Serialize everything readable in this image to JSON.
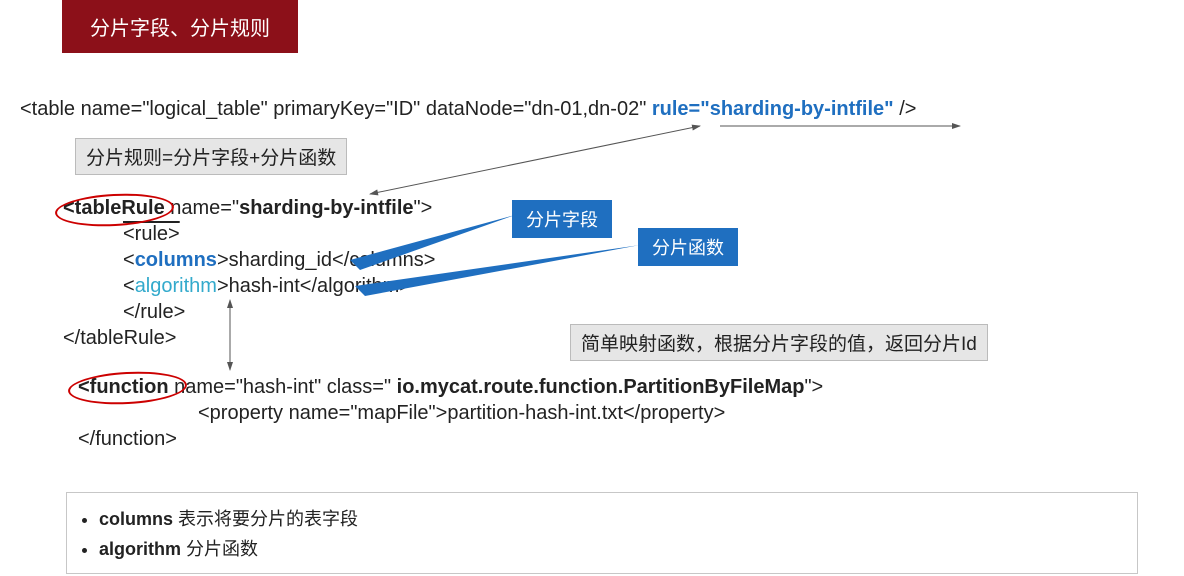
{
  "title": "分片字段、分片规则",
  "tableLine": {
    "prefix": "<table name=\"logical_table\" primaryKey=\"ID\" dataNode=\"dn-01,dn-02\"   ",
    "rule": "rule=\"sharding-by-intfile\"",
    "suffix": " />"
  },
  "formula": "分片规则=分片字段+分片函数",
  "tableRule": {
    "openTag1": "<tableRule",
    "openTag2": " name=\"",
    "ruleName": "sharding-by-intfile",
    "openTag3": "\">",
    "ruleOpen": "<rule>",
    "colOpen1": "<",
    "colTag": "columns",
    "colOpen2": ">",
    "colVal": "sharding_id",
    "colClose": "</columns>",
    "algOpen1": "<",
    "algTag": "algorithm",
    "algOpen2": ">",
    "algVal": "hash-int",
    "algClose": "</algorithm>",
    "ruleClose": "</rule>",
    "closeTag": "</tableRule>"
  },
  "labels": {
    "field": "分片字段",
    "func": "分片函数"
  },
  "descBox": "简单映射函数，根据分片字段的值，返回分片Id",
  "functionBlock": {
    "open1": "<function ",
    "open2": "name=\"hash-int\"   class=\"",
    "classVal": " io.mycat.route.function.PartitionByFileMap",
    "open3": "\">",
    "prop": "<property name=\"mapFile\">partition-hash-int.txt</property>",
    "close": "</function>"
  },
  "notes": {
    "n1a": "columns",
    "n1b": " 表示将要分片的表字段",
    "n2a": "algorithm",
    "n2b": " 分片函数"
  }
}
